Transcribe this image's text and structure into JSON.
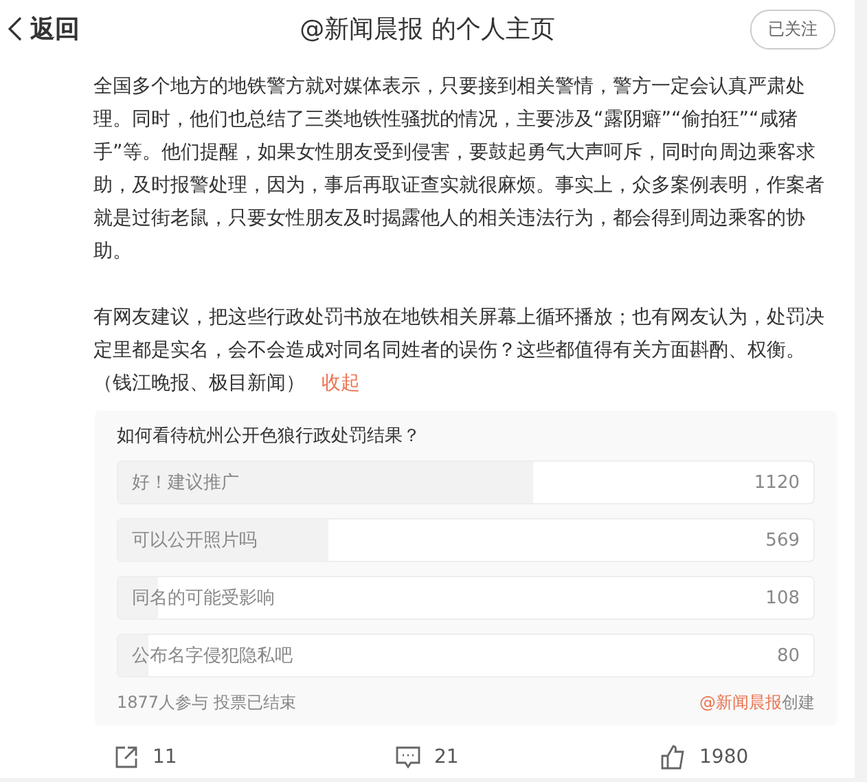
{
  "header": {
    "back": "返回",
    "title": "@新闻晨报 的个人主页",
    "follow": {
      "label": "已关注",
      "followed": true
    }
  },
  "article": {
    "paragraphs": [
      "全国多个地方的地铁警方就对媒体表示，只要接到相关警情，警方一定会认真严肃处理。同时，他们也总结了三类地铁性骚扰的情况，主要涉及“露阴癖”“偷拍狂”“咸猪手”等。他们提醒，如果女性朋友受到侵害，要鼓起勇气大声呵斥，同时向周边乘客求助，及时报警处理，因为，事后再取证查实就很麻烦。事实上，众多案例表明，作案者就是过街老鼠，只要女性朋友及时揭露他人的相关违法行为，都会得到周边乘客的协助。",
      "有网友建议，把这些行政处罚书放在地铁相关屏幕上循环播放；也有网友认为，处罚决定里都是实名，会不会造成对同名同姓者的误伤？这些都值得有关方面斟酌、权衡。（钱江晚报、极目新闻）"
    ],
    "collapse": "收起"
  },
  "poll": {
    "question": "如何看待杭州公开色狼行政处罚结果？",
    "options": [
      {
        "label": "好！建议推广",
        "count": "1120",
        "level": 0.597
      },
      {
        "label": "可以公开照片吗",
        "count": "569",
        "level": 0.303
      },
      {
        "label": "同名的可能受影响",
        "count": "108",
        "level": 0.058
      },
      {
        "label": "公布名字侵犯隐私吧",
        "count": "80",
        "level": 0.043
      }
    ],
    "participants": "1877人参与 投票已结束",
    "creator": "@新闻晨报",
    "created": "创建"
  },
  "actions": [
    {
      "kind": "share",
      "count": "11"
    },
    {
      "kind": "comment",
      "count": "21"
    },
    {
      "kind": "like",
      "count": "1980"
    }
  ]
}
